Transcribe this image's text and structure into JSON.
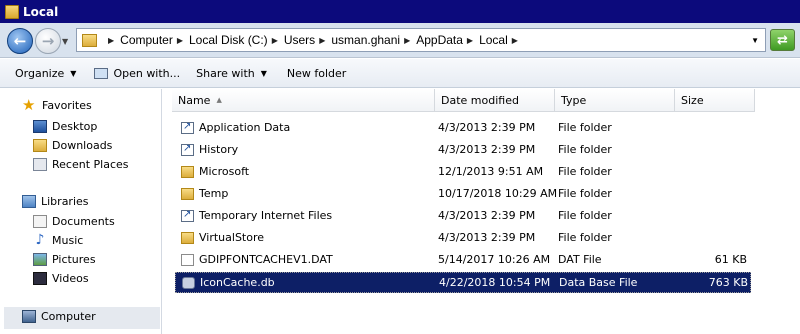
{
  "window": {
    "title": "Local"
  },
  "address": {
    "crumbs": [
      "Computer",
      "Local Disk (C:)",
      "Users",
      "usman.ghani",
      "AppData",
      "Local"
    ]
  },
  "toolbar": {
    "organize": "Organize",
    "open_with": "Open with...",
    "share_with": "Share with",
    "new_folder": "New folder"
  },
  "nav": {
    "favorites": "Favorites",
    "desktop": "Desktop",
    "downloads": "Downloads",
    "recent_places": "Recent Places",
    "libraries": "Libraries",
    "documents": "Documents",
    "music": "Music",
    "pictures": "Pictures",
    "videos": "Videos",
    "computer": "Computer"
  },
  "columns": {
    "name": "Name",
    "date": "Date modified",
    "type": "Type",
    "size": "Size"
  },
  "files": [
    {
      "name": "Application Data",
      "date": "4/3/2013 2:39 PM",
      "type": "File folder",
      "size": "",
      "icon": "shortcut-folder-icon"
    },
    {
      "name": "History",
      "date": "4/3/2013 2:39 PM",
      "type": "File folder",
      "size": "",
      "icon": "shortcut-folder-icon"
    },
    {
      "name": "Microsoft",
      "date": "12/1/2013 9:51 AM",
      "type": "File folder",
      "size": "",
      "icon": "folder-icon"
    },
    {
      "name": "Temp",
      "date": "10/17/2018 10:29 AM",
      "type": "File folder",
      "size": "",
      "icon": "folder-icon"
    },
    {
      "name": "Temporary Internet Files",
      "date": "4/3/2013 2:39 PM",
      "type": "File folder",
      "size": "",
      "icon": "shortcut-folder-icon"
    },
    {
      "name": "VirtualStore",
      "date": "4/3/2013 2:39 PM",
      "type": "File folder",
      "size": "",
      "icon": "folder-icon"
    },
    {
      "name": "GDIPFONTCACHEV1.DAT",
      "date": "5/14/2017 10:26 AM",
      "type": "DAT File",
      "size": "61 KB",
      "icon": "dat-file-icon"
    },
    {
      "name": "IconCache.db",
      "date": "4/22/2018 10:54 PM",
      "type": "Data Base File",
      "size": "763 KB",
      "icon": "database-file-icon",
      "selected": true
    }
  ],
  "colors": {
    "title_bar": "#0c0a7c",
    "selection": "#0d1f66"
  }
}
